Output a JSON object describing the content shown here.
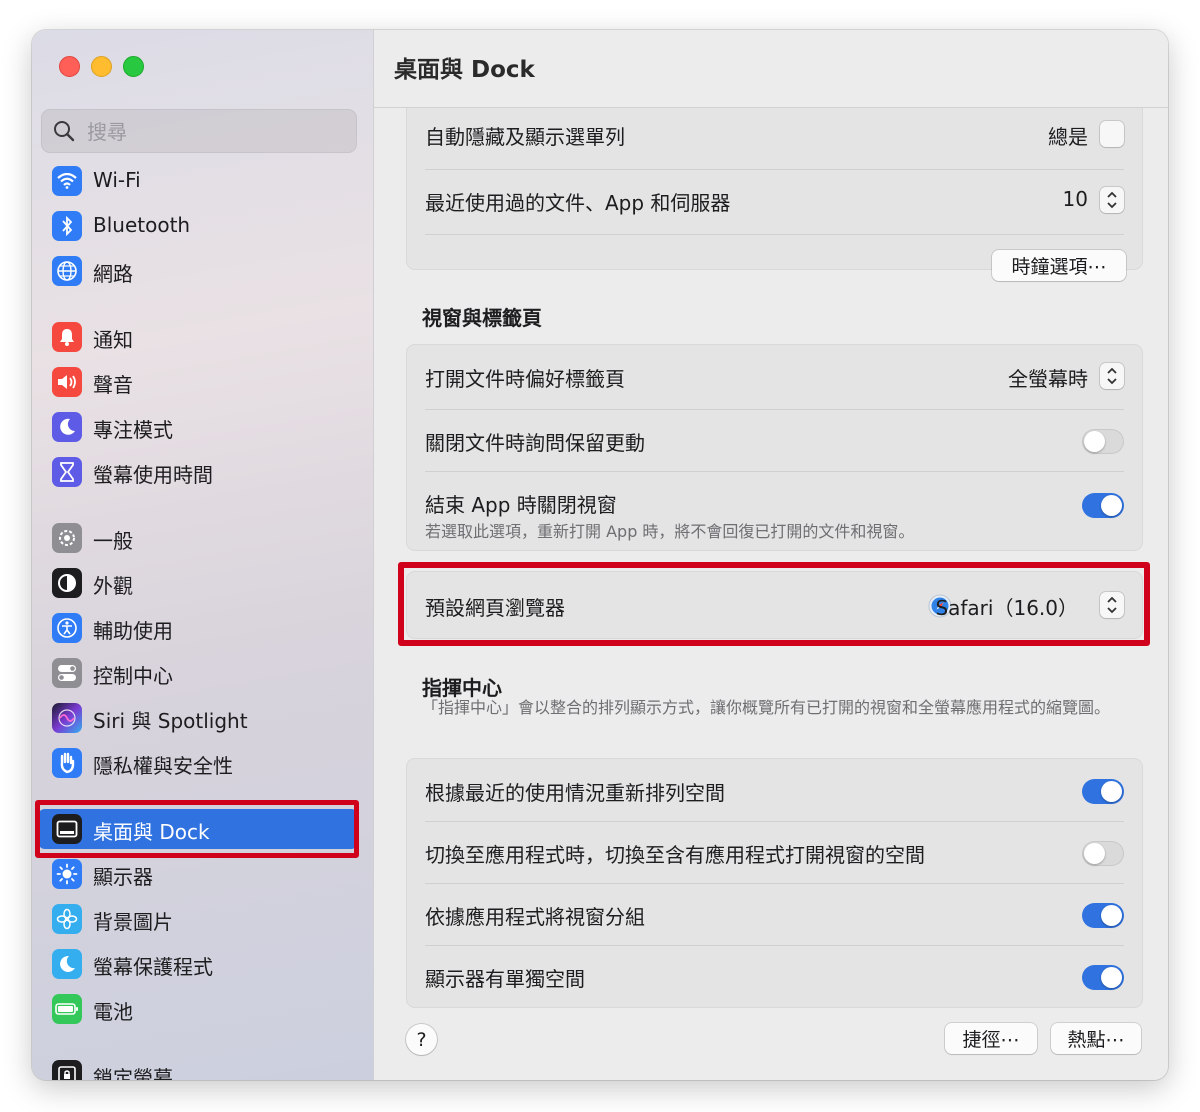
{
  "sidebar": {
    "search_placeholder": "搜尋",
    "items": [
      {
        "label": "Wi-Fi",
        "icon": "wifi-icon",
        "color": "#2f7cf6"
      },
      {
        "label": "Bluetooth",
        "icon": "bluetooth-icon",
        "color": "#2f7cf6"
      },
      {
        "label": "網路",
        "icon": "globe-icon",
        "color": "#2f7cf6"
      },
      {
        "label": "通知",
        "icon": "bell-icon",
        "color": "#f5483e"
      },
      {
        "label": "聲音",
        "icon": "speaker-icon",
        "color": "#f5483e"
      },
      {
        "label": "專注模式",
        "icon": "moon-icon",
        "color": "#5e5ce6"
      },
      {
        "label": "螢幕使用時間",
        "icon": "hourglass-icon",
        "color": "#5e5ce6"
      },
      {
        "label": "一般",
        "icon": "gear-icon",
        "color": "#8e8e93"
      },
      {
        "label": "外觀",
        "icon": "appearance-icon",
        "color": "#1d1d1f"
      },
      {
        "label": "輔助使用",
        "icon": "accessibility-icon",
        "color": "#2f7cf6"
      },
      {
        "label": "控制中心",
        "icon": "switches-icon",
        "color": "#8e8e93"
      },
      {
        "label": "Siri 與 Spotlight",
        "icon": "siri-icon",
        "color": "#7a3ad1"
      },
      {
        "label": "隱私權與安全性",
        "icon": "hand-icon",
        "color": "#2f7cf6"
      },
      {
        "label": "桌面與 Dock",
        "icon": "dock-icon",
        "color": "#1d1d1f"
      },
      {
        "label": "顯示器",
        "icon": "sun-icon",
        "color": "#2f7cf6"
      },
      {
        "label": "背景圖片",
        "icon": "flower-icon",
        "color": "#35aef0"
      },
      {
        "label": "螢幕保護程式",
        "icon": "screensaver-icon",
        "color": "#35aef0"
      },
      {
        "label": "電池",
        "icon": "battery-icon",
        "color": "#34c759"
      },
      {
        "label": "鎖定螢幕",
        "icon": "lock-icon",
        "color": "#1d1d1f"
      }
    ]
  },
  "main": {
    "title": "桌面與 Dock",
    "top_group": {
      "partial_label": "自動隱藏及顯示選單列",
      "partial_value": "總是",
      "recent_label": "最近使用過的文件、App 和伺服器",
      "recent_value": "10",
      "clock_button": "時鐘選項⋯"
    },
    "windows_section": {
      "title": "視窗與標籤頁",
      "prefer_tabs_label": "打開文件時偏好標籤頁",
      "prefer_tabs_value": "全螢幕時",
      "ask_keep_label": "關閉文件時詢問保留更動",
      "ask_keep_on": false,
      "close_windows_label": "結束 App 時關閉視窗",
      "close_windows_desc": "若選取此選項，重新打開 App 時，將不會回復已打開的文件和視窗。",
      "close_windows_on": true
    },
    "browser": {
      "label": "預設網頁瀏覽器",
      "value": "Safari（16.0）",
      "icon": "safari-icon"
    },
    "mission_control": {
      "title": "指揮中心",
      "desc": "「指揮中心」會以整合的排列顯示方式，讓你概覽所有已打開的視窗和全螢幕應用程式的縮覽圖。",
      "rows": [
        {
          "label": "根據最近的使用情況重新排列空間",
          "on": true
        },
        {
          "label": "切換至應用程式時，切換至含有應用程式打開視窗的空間",
          "on": false
        },
        {
          "label": "依據應用程式將視窗分組",
          "on": true
        },
        {
          "label": "顯示器有單獨空間",
          "on": true
        }
      ]
    },
    "footer": {
      "help": "?",
      "shortcuts_button": "捷徑⋯",
      "hot_corners_button": "熱點⋯"
    }
  },
  "colors": {
    "accent": "#2f72e0",
    "highlight": "#d0021b"
  }
}
